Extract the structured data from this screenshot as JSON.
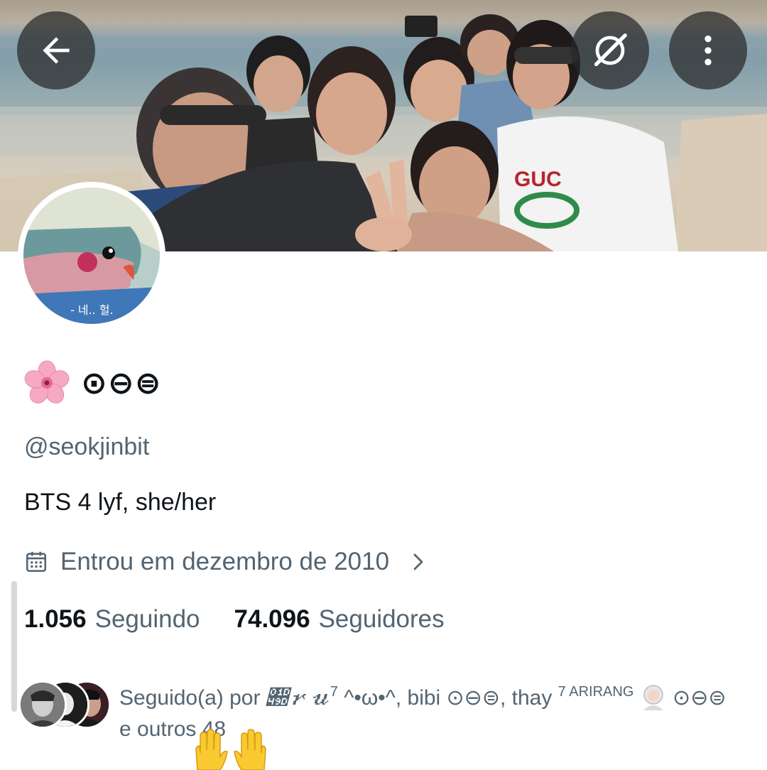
{
  "header": {
    "back_icon": "arrow-left-icon",
    "grok_icon": "grok-slash-icon",
    "more_icon": "more-vertical-icon",
    "banner_badge": "GUC"
  },
  "profile": {
    "name_emoji": "flower-emoji",
    "display_name": "⊙⊖⊜",
    "handle": "@seokjinbit",
    "bio": "BTS 4 lyf, she/her",
    "avatar_caption": "- 네.. 헐."
  },
  "joined": {
    "icon": "calendar-icon",
    "text": "Entrou em dezembro de 2010",
    "chevron_icon": "chevron-right-icon"
  },
  "stats": {
    "following_count": "1.056",
    "following_label": "Seguindo",
    "followers_count": "74.096",
    "followers_label": "Seguidores"
  },
  "followed_by": {
    "prefix": "Seguido(a) por ",
    "user1_name": "𝒝𝓇𝓊",
    "user1_sup": "7",
    "user1_face": " ^•ω•^",
    "sep1": ", bibi ⊙⊖⊜, thay ",
    "user3_sup": "7 ARIRANG",
    "user3_emoji": "astronaut-emoji",
    "user3_tail": " ⊙⊖⊜",
    "suffix": "e outros 48",
    "trailing_emoji": "raising-hands-emoji"
  },
  "colors": {
    "text_primary": "#0f1419",
    "text_secondary": "#536471",
    "overlay_button": "#282828"
  }
}
